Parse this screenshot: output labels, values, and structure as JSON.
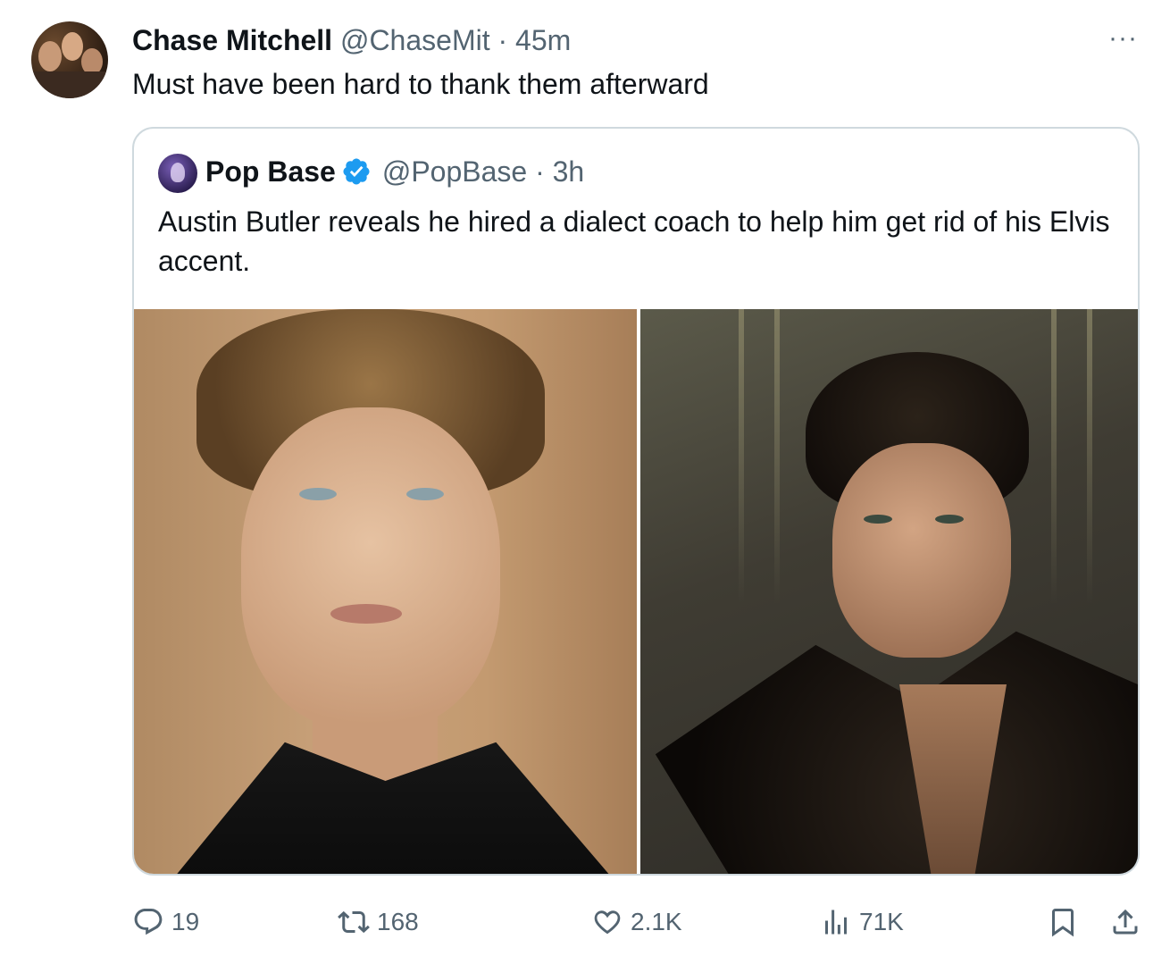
{
  "tweet": {
    "author_name": "Chase Mitchell",
    "handle": "@ChaseMit",
    "separator": "·",
    "time": "45m",
    "text": "Must have been hard to thank them afterward",
    "more": "···"
  },
  "quoted": {
    "author_name": "Pop Base",
    "handle": "@PopBase",
    "separator": "·",
    "time": "3h",
    "verified_color": "#1d9bf0",
    "text": "Austin Butler reveals he hired a dialect coach to help him get rid of his Elvis accent."
  },
  "actions": {
    "replies": "19",
    "reposts": "168",
    "likes": "2.1K",
    "views": "71K"
  },
  "colors": {
    "text": "#0f1419",
    "muted": "#536471",
    "border": "#cfd9de"
  }
}
